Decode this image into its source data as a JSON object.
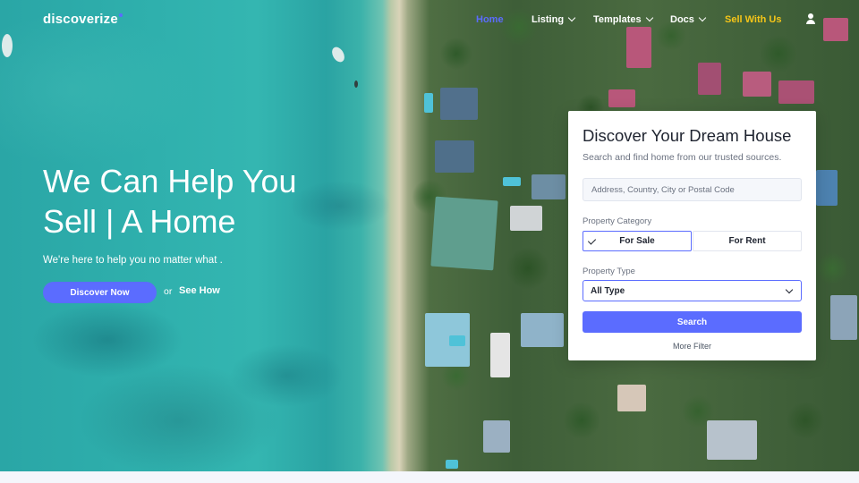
{
  "brand": {
    "name": "discoverize",
    "accent": "#5b6cff",
    "highlight": "#f5c518"
  },
  "nav": {
    "home": "Home",
    "listing": "Listing",
    "templates": "Templates",
    "docs": "Docs",
    "sell": "Sell With Us",
    "user_icon": "user-icon"
  },
  "hero": {
    "title_line1": "We Can Help You",
    "title_line2": "Sell | A Home",
    "subtitle": "We're here to help you no matter what .",
    "cta_primary": "Discover Now",
    "or": "or",
    "cta_secondary": "See How"
  },
  "search_card": {
    "title": "Discover Your Dream House",
    "subtitle": "Search and find home from our trusted sources.",
    "address_placeholder": "Address, Country, City or Postal Code",
    "category_label": "Property Category",
    "for_sale": "For Sale",
    "for_rent": "For Rent",
    "selected_category": "For Sale",
    "type_label": "Property Type",
    "type_value": "All Type",
    "search_button": "Search",
    "more_filter": "More Filter"
  }
}
